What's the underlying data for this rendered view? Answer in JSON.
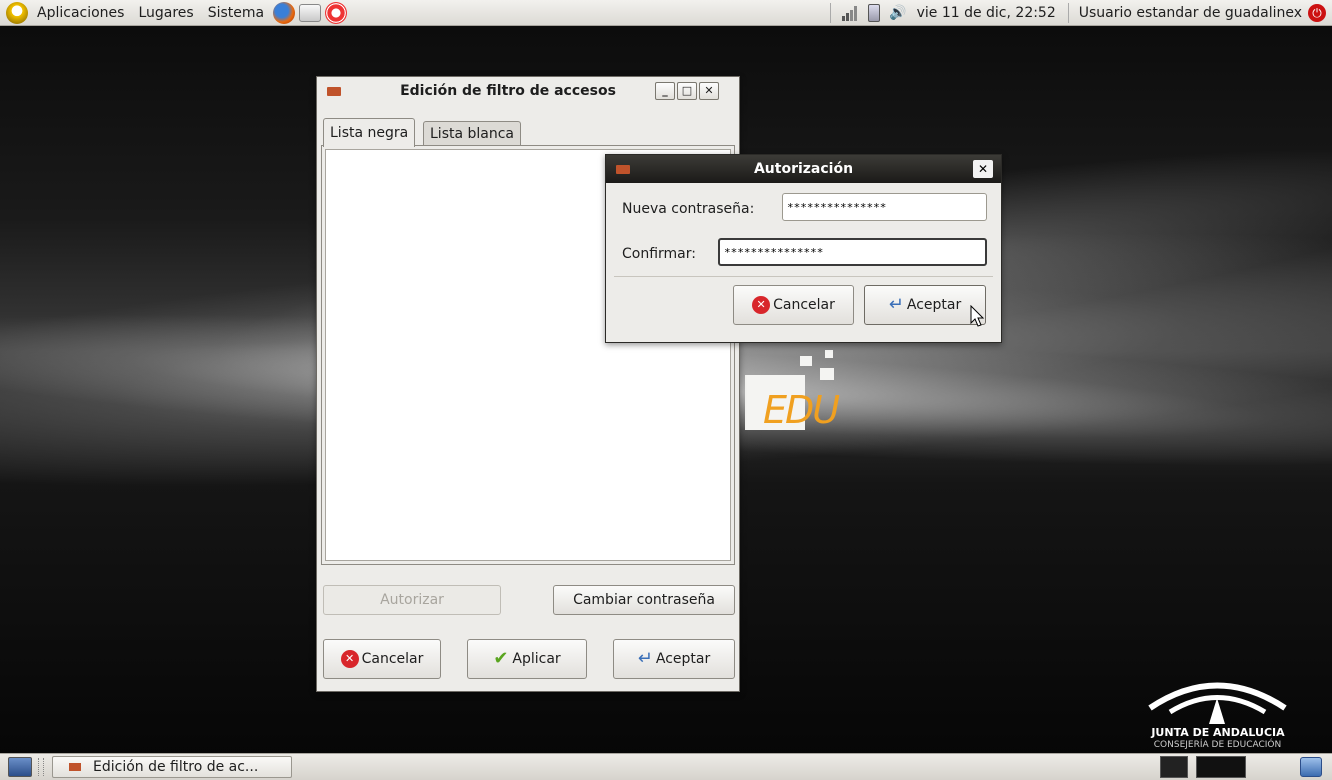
{
  "top_panel": {
    "menus": [
      "Aplicaciones",
      "Lugares",
      "Sistema"
    ],
    "clock": "vie 11 de dic, 22:52",
    "user": "Usuario estandar de guadalinex"
  },
  "main_window": {
    "title": "Edición de filtro de accesos",
    "tabs": [
      "Lista negra",
      "Lista blanca"
    ],
    "authorize_label": "Autorizar",
    "change_password_label": "Cambiar contraseña",
    "cancel_label": "Cancelar",
    "apply_label": "Aplicar",
    "accept_label": "Aceptar"
  },
  "auth_dialog": {
    "title": "Autorización",
    "new_password_label": "Nueva contraseña:",
    "new_password_value": "***************",
    "confirm_label": "Confirmar:",
    "confirm_value": "***************",
    "cancel_label": "Cancelar",
    "accept_label": "Aceptar"
  },
  "taskbar": {
    "task_label": "Edición de filtro de ac..."
  },
  "wallpaper": {
    "edu_logo_text": "EDU",
    "junta_line1": "JUNTA DE ANDALUCIA",
    "junta_line2": "CONSEJERÍA DE EDUCACIÓN"
  },
  "colors": {
    "panel": "#dcdad5",
    "window_bg": "#edece9",
    "cancel_red": "#d8262b",
    "power_red": "#cc1111",
    "edu_orange": "#f0a020"
  }
}
